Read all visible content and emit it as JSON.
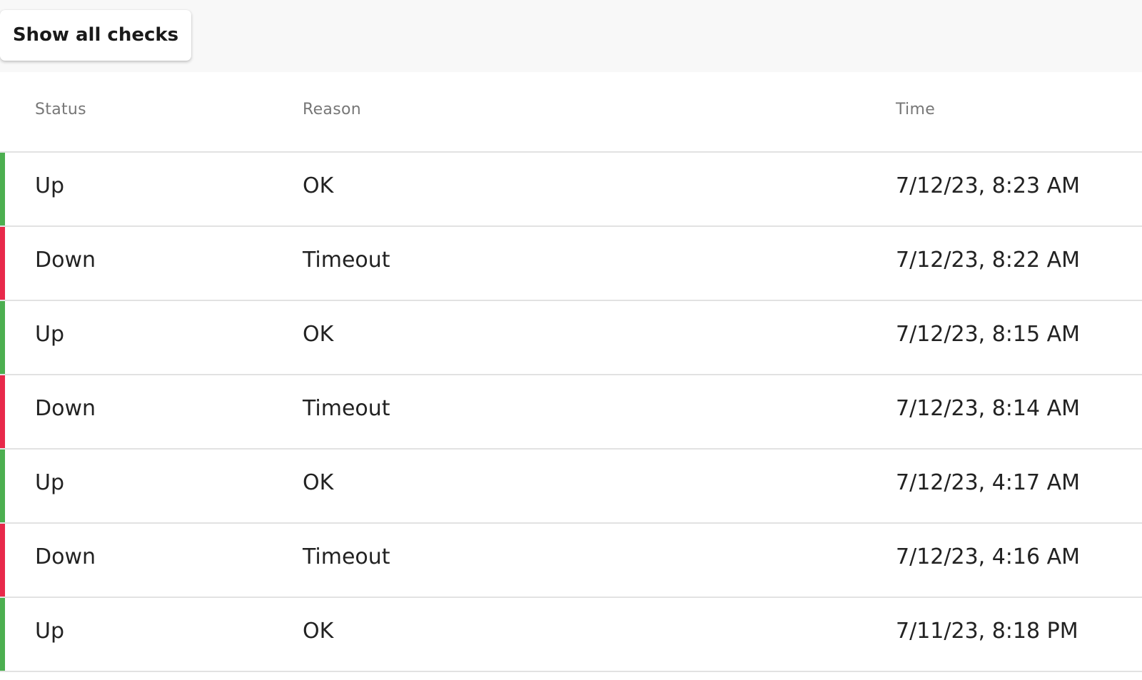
{
  "toolbar": {
    "show_all_label": "Show all checks"
  },
  "colors": {
    "up": "#4caf50",
    "down": "#e8294a"
  },
  "table": {
    "columns": [
      "Status",
      "Reason",
      "Time"
    ],
    "rows": [
      {
        "status": "Up",
        "reason": "OK",
        "time": "7/12/23, 8:23 AM"
      },
      {
        "status": "Down",
        "reason": "Timeout",
        "time": "7/12/23, 8:22 AM"
      },
      {
        "status": "Up",
        "reason": "OK",
        "time": "7/12/23, 8:15 AM"
      },
      {
        "status": "Down",
        "reason": "Timeout",
        "time": "7/12/23, 8:14 AM"
      },
      {
        "status": "Up",
        "reason": "OK",
        "time": "7/12/23, 4:17 AM"
      },
      {
        "status": "Down",
        "reason": "Timeout",
        "time": "7/12/23, 4:16 AM"
      },
      {
        "status": "Up",
        "reason": "OK",
        "time": "7/11/23, 8:18 PM"
      }
    ]
  }
}
